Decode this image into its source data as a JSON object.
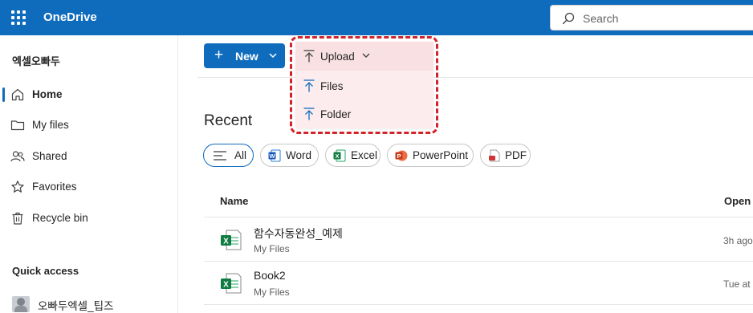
{
  "app": {
    "brand": "OneDrive",
    "search_placeholder": "Search"
  },
  "sidebar": {
    "account": "엑셀오빠두",
    "items": [
      {
        "label": "Home",
        "active": true
      },
      {
        "label": "My files"
      },
      {
        "label": "Shared"
      },
      {
        "label": "Favorites"
      },
      {
        "label": "Recycle bin"
      }
    ],
    "quick_access_title": "Quick access",
    "quick_access_items": [
      {
        "label": "오빠두엑셀_팁즈"
      }
    ]
  },
  "commandbar": {
    "new_label": "New",
    "upload_label": "Upload",
    "upload_menu": [
      {
        "label": "Files"
      },
      {
        "label": "Folder"
      }
    ]
  },
  "recent": {
    "title": "Recent",
    "filters": [
      {
        "label": "All",
        "selected": true
      },
      {
        "label": "Word"
      },
      {
        "label": "Excel"
      },
      {
        "label": "PowerPoint"
      },
      {
        "label": "PDF"
      }
    ],
    "columns": {
      "name": "Name",
      "opened": "Open"
    },
    "files": [
      {
        "name": "함수자동완성_예제",
        "location": "My Files",
        "opened": "3h ago"
      },
      {
        "name": "Book2",
        "location": "My Files",
        "opened": "Tue at"
      }
    ]
  },
  "colors": {
    "brand": "#0f6cbd",
    "excel": "#107c41",
    "word": "#185abd",
    "powerpoint": "#c43e1c",
    "pdf": "#d13438",
    "annotation": "#d2232a"
  }
}
